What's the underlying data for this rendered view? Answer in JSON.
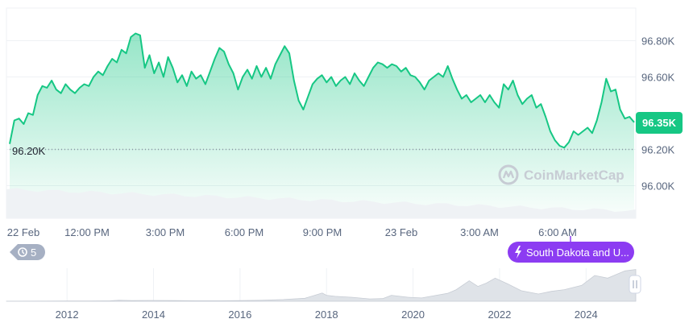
{
  "chart_data": [
    {
      "type": "line",
      "title": "",
      "xlabel": "",
      "ylabel": "",
      "x_ticks": [
        "22 Feb",
        "12:00 PM",
        "3:00 PM",
        "6:00 PM",
        "9:00 PM",
        "23 Feb",
        "3:00 AM",
        "6:00 AM"
      ],
      "y_ticks": [
        "96.80K",
        "96.60K",
        "96.20K",
        "96.00K"
      ],
      "ylim": [
        95.82,
        96.98
      ],
      "grid": true,
      "start_label": "96.20K",
      "current_price_label": "96.35K",
      "line_color": "#16c784",
      "series": [
        {
          "values": [
            96.23,
            96.36,
            96.37,
            96.34,
            96.4,
            96.39,
            96.5,
            96.55,
            96.54,
            96.58,
            96.53,
            96.51,
            96.56,
            96.53,
            96.51,
            96.54,
            96.56,
            96.55,
            96.6,
            96.63,
            96.61,
            96.66,
            96.7,
            96.68,
            96.75,
            96.73,
            96.82,
            96.84,
            96.83,
            96.65,
            96.72,
            96.62,
            96.68,
            96.6,
            96.71,
            96.65,
            96.57,
            96.61,
            96.55,
            96.63,
            96.59,
            96.61,
            96.56,
            96.63,
            96.7,
            96.76,
            96.74,
            96.67,
            96.62,
            96.53,
            96.6,
            96.64,
            96.59,
            96.66,
            96.6,
            96.65,
            96.59,
            96.67,
            96.72,
            96.77,
            96.73,
            96.58,
            96.47,
            96.42,
            96.49,
            96.56,
            96.59,
            96.61,
            96.57,
            96.6,
            96.55,
            96.58,
            96.6,
            96.56,
            96.62,
            96.58,
            96.55,
            96.6,
            96.65,
            96.68,
            96.67,
            96.65,
            96.67,
            96.66,
            96.63,
            96.65,
            96.61,
            96.6,
            96.57,
            96.53,
            96.58,
            96.6,
            96.62,
            96.6,
            96.66,
            96.59,
            96.53,
            96.48,
            96.5,
            96.46,
            96.48,
            96.5,
            96.46,
            96.5,
            96.46,
            96.43,
            96.56,
            96.53,
            96.58,
            96.5,
            96.45,
            96.48,
            96.5,
            96.43,
            96.45,
            96.38,
            96.3,
            96.25,
            96.22,
            96.21,
            96.24,
            96.3,
            96.28,
            96.3,
            96.32,
            96.29,
            96.36,
            96.46,
            96.59,
            96.52,
            96.53,
            96.42,
            96.37,
            96.38,
            96.35
          ]
        }
      ]
    },
    {
      "type": "area",
      "title": "",
      "xlabel": "",
      "ylabel": "",
      "x_ticks": [
        "2012",
        "2014",
        "2016",
        "2018",
        "2020",
        "2022",
        "2024"
      ],
      "x_range": [
        2010.6,
        2025.15
      ],
      "ylim": [
        0,
        100
      ],
      "series": [
        {
          "x": [
            2010.6,
            2011.5,
            2012.0,
            2012.5,
            2013.0,
            2013.2,
            2013.5,
            2013.9,
            2014.5,
            2015.0,
            2015.5,
            2016.0,
            2016.5,
            2017.0,
            2017.5,
            2017.9,
            2018.0,
            2018.2,
            2018.6,
            2019.0,
            2019.3,
            2019.5,
            2019.9,
            2020.2,
            2020.5,
            2020.8,
            2021.0,
            2021.3,
            2021.5,
            2021.7,
            2021.9,
            2022.2,
            2022.5,
            2022.9,
            2023.2,
            2023.5,
            2023.9,
            2024.2,
            2024.5,
            2024.9,
            2025.15
          ],
          "values": [
            0.3,
            0.4,
            0.8,
            1,
            1.5,
            3,
            2,
            2.5,
            2,
            1.5,
            1.5,
            2,
            3,
            5,
            9,
            25,
            18,
            15,
            12,
            7,
            8,
            18,
            12,
            10,
            17,
            24,
            35,
            62,
            45,
            55,
            70,
            52,
            32,
            22,
            30,
            35,
            48,
            78,
            70,
            92,
            96
          ]
        }
      ]
    }
  ],
  "watermark": {
    "brand": "CoinMarketCap"
  },
  "history_badge": {
    "count": "5"
  },
  "event_pill": {
    "label": "South Dakota and U..."
  },
  "colors": {
    "up_green": "#16c784",
    "event_purple": "#8c3cf2",
    "badge_gray": "#a6b0c3",
    "volume_gray": "#eff2f5"
  }
}
